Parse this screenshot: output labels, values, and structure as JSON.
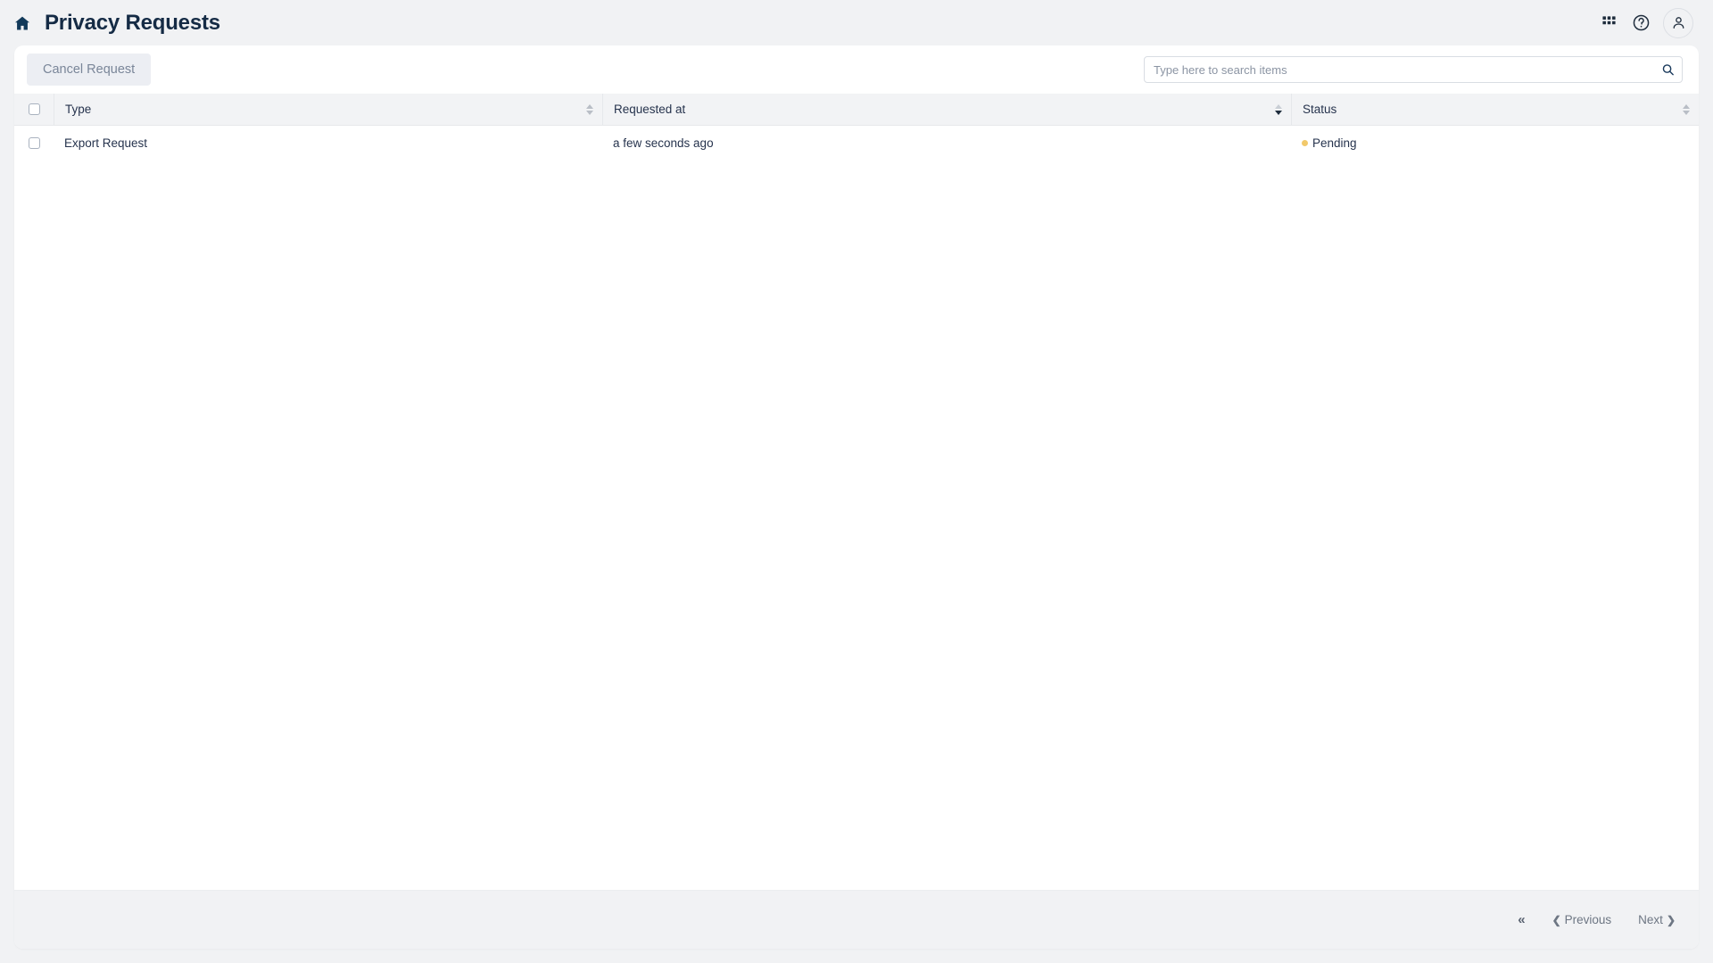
{
  "header": {
    "home_icon": "home-icon",
    "title": "Privacy Requests",
    "apps_icon": "apps-grid-icon",
    "help_icon": "help-circle-icon",
    "avatar_icon": "user-avatar-icon"
  },
  "toolbar": {
    "cancel_label": "Cancel Request",
    "search_placeholder": "Type here to search items",
    "search_value": "",
    "search_icon": "search-icon"
  },
  "table": {
    "select_all_checkbox": false,
    "columns": [
      {
        "label": "Type",
        "sort": "none"
      },
      {
        "label": "Requested at",
        "sort": "desc"
      },
      {
        "label": "Status",
        "sort": "none"
      }
    ],
    "rows": [
      {
        "selected": false,
        "type": "Export Request",
        "requested_at": "a few seconds ago",
        "status": "Pending",
        "status_color": "#f2c96b"
      }
    ]
  },
  "pagination": {
    "first_label": "«",
    "previous_label": "Previous",
    "next_label": "Next"
  },
  "colors": {
    "page_background": "#f1f2f4",
    "card_background": "#ffffff",
    "title": "#152b45",
    "header_row": "#f2f3f5",
    "accent_navy": "#123a5a",
    "pending": "#f2c96b",
    "disabled_button_bg": "#eceef3",
    "disabled_button_text": "#7a8699"
  }
}
